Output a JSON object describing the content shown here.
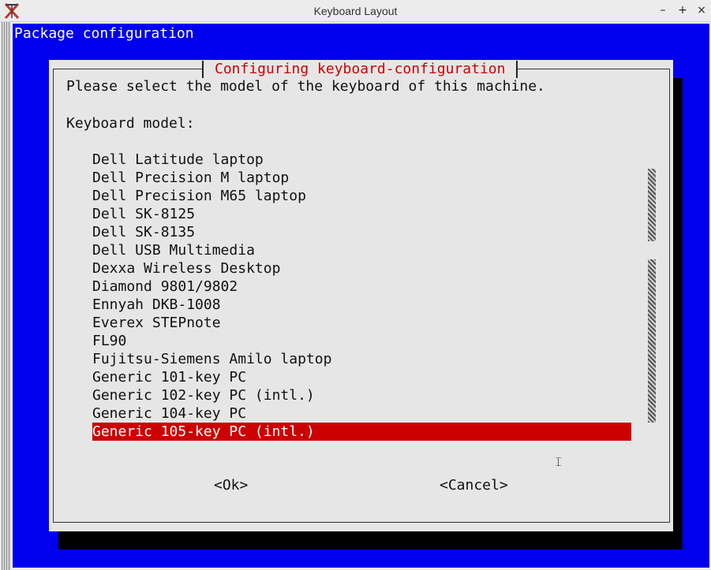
{
  "window": {
    "title": "Keyboard Layout",
    "controls": {
      "minimize": "–",
      "maximize": "+",
      "close": "×"
    }
  },
  "header": {
    "title": "Package configuration"
  },
  "dialog": {
    "title": "Configuring keyboard-configuration",
    "prompt": "Please select the model of the keyboard of this machine.",
    "list_label": "Keyboard model:",
    "items": [
      "Dell Latitude laptop",
      "Dell Precision M laptop",
      "Dell Precision M65 laptop",
      "Dell SK-8125",
      "Dell SK-8135",
      "Dell USB Multimedia",
      "Dexxa Wireless Desktop",
      "Diamond 9801/9802",
      "Ennyah DKB-1008",
      "Everex STEPnote",
      "FL90",
      "Fujitsu-Siemens Amilo laptop",
      "Generic 101-key PC",
      "Generic 102-key PC (intl.)",
      "Generic 104-key PC",
      "Generic 105-key PC (intl.)"
    ],
    "selected_item": "Generic 105-key PC (intl.)",
    "buttons": {
      "ok": "<Ok>",
      "cancel": "<Cancel>"
    }
  },
  "colors": {
    "background": "#0000ee",
    "dialog": "#e6e6e6",
    "title_text": "#cc0000",
    "selection": "#cc0000",
    "shadow": "#000000"
  },
  "icons": {
    "app": "xterm-x-icon",
    "cursor": "text-cursor-icon"
  }
}
